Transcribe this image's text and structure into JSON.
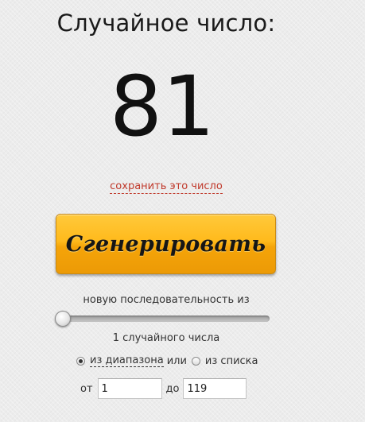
{
  "header": {
    "title": "Случайное число:"
  },
  "result": {
    "number": "81",
    "save_link": "сохранить это число"
  },
  "generate_button": {
    "label": "Сгенерировать"
  },
  "sequence": {
    "label": "новую последовательность из",
    "slider_value": 1,
    "count_label": "1 случайного числа"
  },
  "mode": {
    "range_label": "из диапазона",
    "or_text": "или",
    "list_label": "из списка",
    "selected": "range"
  },
  "range": {
    "from_label": "от",
    "from_value": "1",
    "to_label": "до",
    "to_value": "119"
  },
  "colors": {
    "button": "#ffba1c",
    "link": "#c0392b"
  }
}
